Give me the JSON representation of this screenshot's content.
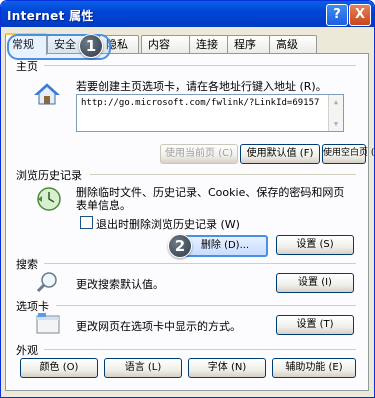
{
  "window": {
    "title": "Internet 属性",
    "help": "?",
    "close": "X"
  },
  "tabs": [
    "常规",
    "安全",
    "隐私",
    "内容",
    "连接",
    "程序",
    "高级"
  ],
  "badges": {
    "one": "1",
    "two": "2"
  },
  "home": {
    "label": "主页",
    "hint": "若要创建主页选项卡，请在各地址行键入地址 (R)。",
    "url": "http://go.microsoft.com/fwlink/?LinkId=69157",
    "use_current": "使用当前页 (C)",
    "use_default": "使用默认值 (F)",
    "use_blank": "使用空白页 (B)"
  },
  "history": {
    "label": "浏览历史记录",
    "desc_line1": "删除临时文件、历史记录、Cookie、保存的密码和网页",
    "desc_line2": "表单信息。",
    "checkbox": "退出时删除浏览历史记录 (W)",
    "delete": "删除 (D)...",
    "settings": "设置 (S)"
  },
  "search": {
    "label": "搜索",
    "desc": "更改搜索默认值。",
    "settings": "设置 (I)"
  },
  "tabsgrp": {
    "label": "选项卡",
    "desc": "更改网页在选项卡中显示的方式。",
    "settings": "设置 (T)"
  },
  "appearance": {
    "label": "外观",
    "colors": "颜色 (O)",
    "languages": "语言 (L)",
    "fonts": "字体 (N)",
    "accessibility": "辅助功能 (E)"
  }
}
